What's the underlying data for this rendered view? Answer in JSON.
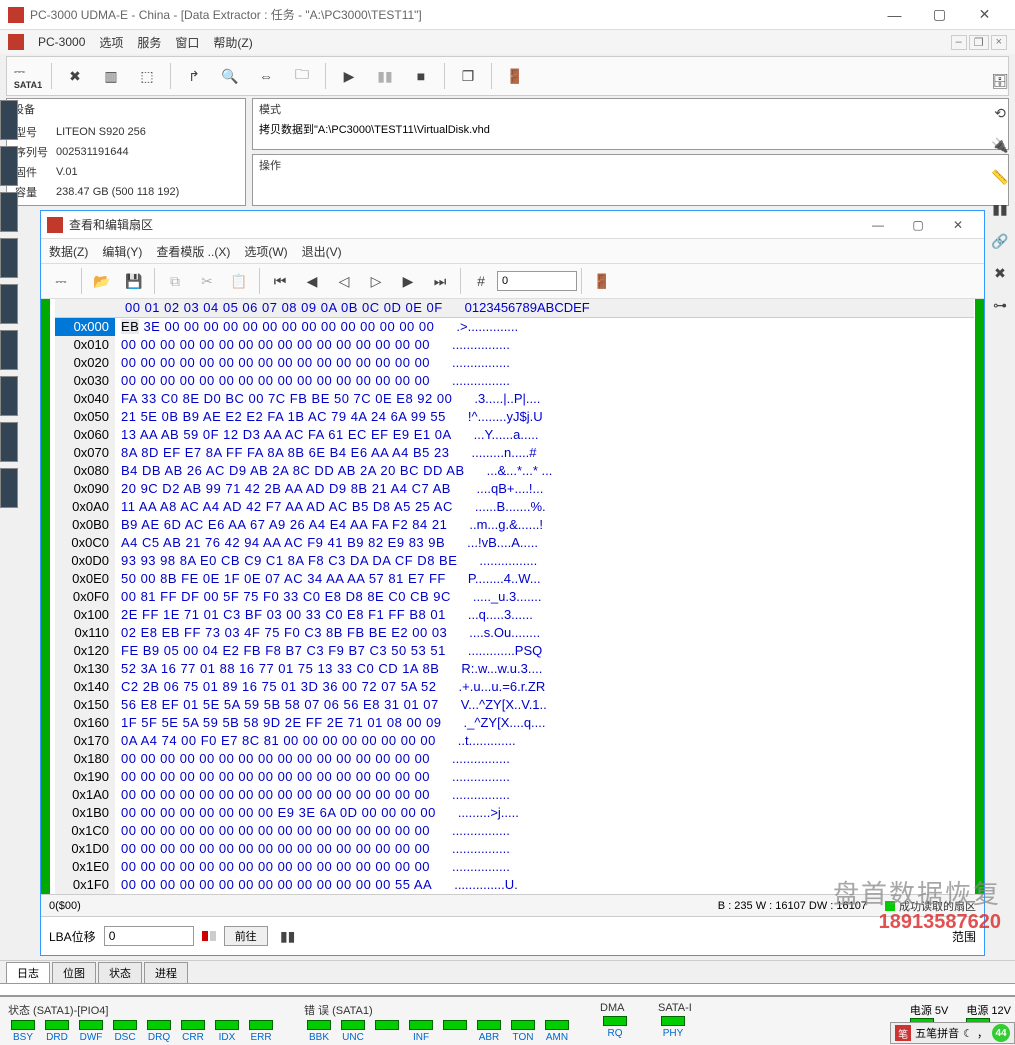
{
  "window": {
    "title": "PC-3000 UDMA-E - China - [Data Extractor : 任务 - \"A:\\PC3000\\TEST11\"]"
  },
  "main_menu": {
    "items": [
      "PC-3000",
      "选项",
      "服务",
      "窗口",
      "帮助(Z)"
    ]
  },
  "toolbar_main": {
    "sata_label": "SATA1"
  },
  "device_panel": {
    "title": "设备",
    "rows": [
      {
        "label": "型号",
        "value": "LITEON S920 256"
      },
      {
        "label": "序列号",
        "value": "002531191644"
      },
      {
        "label": "固件",
        "value": "V.01"
      },
      {
        "label": "容量",
        "value": "238.47 GB (500 118 192)"
      }
    ]
  },
  "mode_panel": {
    "title": "模式",
    "value": "拷贝数据到\"A:\\PC3000\\TEST11\\VirtualDisk.vhd"
  },
  "op_panel": {
    "title": "操作"
  },
  "inner": {
    "title": "查看和编辑扇区",
    "menu": [
      "数据(Z)",
      "编辑(Y)",
      "查看模版 ..(X)",
      "选项(W)",
      "退出(V)"
    ],
    "input_value": "0"
  },
  "hex": {
    "header_offsets": "00 01 02 03 04 05 06 07 08 09 0A 0B 0C 0D 0E 0F",
    "header_ascii": "0123456789ABCDEF",
    "rows": [
      {
        "addr": "0x000",
        "selected": true,
        "bytes": [
          "EB",
          "3E",
          "00",
          "00",
          "00",
          "00",
          "00",
          "00",
          "00",
          "00",
          "00",
          "00",
          "00",
          "00",
          "00",
          "00"
        ],
        "ascii": ".>.............."
      },
      {
        "addr": "0x010",
        "bytes": [
          "00",
          "00",
          "00",
          "00",
          "00",
          "00",
          "00",
          "00",
          "00",
          "00",
          "00",
          "00",
          "00",
          "00",
          "00",
          "00"
        ],
        "ascii": "................"
      },
      {
        "addr": "0x020",
        "bytes": [
          "00",
          "00",
          "00",
          "00",
          "00",
          "00",
          "00",
          "00",
          "00",
          "00",
          "00",
          "00",
          "00",
          "00",
          "00",
          "00"
        ],
        "ascii": "................"
      },
      {
        "addr": "0x030",
        "bytes": [
          "00",
          "00",
          "00",
          "00",
          "00",
          "00",
          "00",
          "00",
          "00",
          "00",
          "00",
          "00",
          "00",
          "00",
          "00",
          "00"
        ],
        "ascii": "................"
      },
      {
        "addr": "0x040",
        "bytes": [
          "FA",
          "33",
          "C0",
          "8E",
          "D0",
          "BC",
          "00",
          "7C",
          "FB",
          "BE",
          "50",
          "7C",
          "0E",
          "E8",
          "92",
          "00"
        ],
        "ascii": ".3.....|..P|...."
      },
      {
        "addr": "0x050",
        "bytes": [
          "21",
          "5E",
          "0B",
          "B9",
          "AE",
          "E2",
          "E2",
          "FA",
          "1B",
          "AC",
          "79",
          "4A",
          "24",
          "6A",
          "99",
          "55"
        ],
        "ascii": "!^........yJ$j.U"
      },
      {
        "addr": "0x060",
        "bytes": [
          "13",
          "AA",
          "AB",
          "59",
          "0F",
          "12",
          "D3",
          "AA",
          "AC",
          "FA",
          "61",
          "EC",
          "EF",
          "E9",
          "E1",
          "0A"
        ],
        "ascii": "...Y......a....."
      },
      {
        "addr": "0x070",
        "bytes": [
          "8A",
          "8D",
          "EF",
          "E7",
          "8A",
          "FF",
          "FA",
          "8A",
          "8B",
          "6E",
          "B4",
          "E6",
          "AA",
          "A4",
          "B5",
          "23"
        ],
        "ascii": ".........n.....#"
      },
      {
        "addr": "0x080",
        "bytes": [
          "B4",
          "DB",
          "AB",
          "26",
          "AC",
          "D9",
          "AB",
          "2A",
          "8C",
          "DD",
          "AB",
          "2A",
          "20",
          "BC",
          "DD",
          "AB"
        ],
        "ascii": "...&...*...* ..."
      },
      {
        "addr": "0x090",
        "bytes": [
          "20",
          "9C",
          "D2",
          "AB",
          "99",
          "71",
          "42",
          "2B",
          "AA",
          "AD",
          "D9",
          "8B",
          "21",
          "A4",
          "C7",
          "AB"
        ],
        "ascii": " ....qB+....!..."
      },
      {
        "addr": "0x0A0",
        "bytes": [
          "11",
          "AA",
          "A8",
          "AC",
          "A4",
          "AD",
          "42",
          "F7",
          "AA",
          "AD",
          "AC",
          "B5",
          "D8",
          "A5",
          "25",
          "AC"
        ],
        "ascii": "......B.......%."
      },
      {
        "addr": "0x0B0",
        "bytes": [
          "B9",
          "AE",
          "6D",
          "AC",
          "E6",
          "AA",
          "67",
          "A9",
          "26",
          "A4",
          "E4",
          "AA",
          "FA",
          "F2",
          "84",
          "21"
        ],
        "ascii": "..m...g.&......!"
      },
      {
        "addr": "0x0C0",
        "bytes": [
          "A4",
          "C5",
          "AB",
          "21",
          "76",
          "42",
          "94",
          "AA",
          "AC",
          "F9",
          "41",
          "B9",
          "82",
          "E9",
          "83",
          "9B"
        ],
        "ascii": "...!vB....A....."
      },
      {
        "addr": "0x0D0",
        "bytes": [
          "93",
          "93",
          "98",
          "8A",
          "E0",
          "CB",
          "C9",
          "C1",
          "8A",
          "F8",
          "C3",
          "DA",
          "DA",
          "CF",
          "D8",
          "BE"
        ],
        "ascii": "................"
      },
      {
        "addr": "0x0E0",
        "bytes": [
          "50",
          "00",
          "8B",
          "FE",
          "0E",
          "1F",
          "0E",
          "07",
          "AC",
          "34",
          "AA",
          "AA",
          "57",
          "81",
          "E7",
          "FF"
        ],
        "ascii": "P........4..W..."
      },
      {
        "addr": "0x0F0",
        "bytes": [
          "00",
          "81",
          "FF",
          "DF",
          "00",
          "5F",
          "75",
          "F0",
          "33",
          "C0",
          "E8",
          "D8",
          "8E",
          "C0",
          "CB",
          "9C"
        ],
        "ascii": "....._u.3......."
      },
      {
        "addr": "0x100",
        "bytes": [
          "2E",
          "FF",
          "1E",
          "71",
          "01",
          "C3",
          "BF",
          "03",
          "00",
          "33",
          "C0",
          "E8",
          "F1",
          "FF",
          "B8",
          "01"
        ],
        "ascii": "...q.....3......"
      },
      {
        "addr": "0x110",
        "bytes": [
          "02",
          "E8",
          "EB",
          "FF",
          "73",
          "03",
          "4F",
          "75",
          "F0",
          "C3",
          "8B",
          "FB",
          "BE",
          "E2",
          "00",
          "03"
        ],
        "ascii": "....s.Ou........"
      },
      {
        "addr": "0x120",
        "bytes": [
          "FE",
          "B9",
          "05",
          "00",
          "04",
          "E2",
          "FB",
          "F8",
          "B7",
          "C3",
          "F9",
          "B7",
          "C3",
          "50",
          "53",
          "51"
        ],
        "ascii": ".............PSQ"
      },
      {
        "addr": "0x130",
        "bytes": [
          "52",
          "3A",
          "16",
          "77",
          "01",
          "88",
          "16",
          "77",
          "01",
          "75",
          "13",
          "33",
          "C0",
          "CD",
          "1A",
          "8B"
        ],
        "ascii": "R:.w...w.u.3...."
      },
      {
        "addr": "0x140",
        "bytes": [
          "C2",
          "2B",
          "06",
          "75",
          "01",
          "89",
          "16",
          "75",
          "01",
          "3D",
          "36",
          "00",
          "72",
          "07",
          "5A",
          "52"
        ],
        "ascii": ".+.u...u.=6.r.ZR"
      },
      {
        "addr": "0x150",
        "bytes": [
          "56",
          "E8",
          "EF",
          "01",
          "5E",
          "5A",
          "59",
          "5B",
          "58",
          "07",
          "06",
          "56",
          "E8",
          "31",
          "01",
          "07"
        ],
        "ascii": "V...^ZY[X..V.1.."
      },
      {
        "addr": "0x160",
        "bytes": [
          "1F",
          "5F",
          "5E",
          "5A",
          "59",
          "5B",
          "58",
          "9D",
          "2E",
          "FF",
          "2E",
          "71",
          "01",
          "08",
          "00",
          "09"
        ],
        "ascii": "._^ZY[X....q...."
      },
      {
        "addr": "0x170",
        "bytes": [
          "0A",
          "A4",
          "74",
          "00",
          "F0",
          "E7",
          "8C",
          "81",
          "00",
          "00",
          "00",
          "00",
          "00",
          "00",
          "00",
          "00"
        ],
        "ascii": "..t............."
      },
      {
        "addr": "0x180",
        "bytes": [
          "00",
          "00",
          "00",
          "00",
          "00",
          "00",
          "00",
          "00",
          "00",
          "00",
          "00",
          "00",
          "00",
          "00",
          "00",
          "00"
        ],
        "ascii": "................"
      },
      {
        "addr": "0x190",
        "bytes": [
          "00",
          "00",
          "00",
          "00",
          "00",
          "00",
          "00",
          "00",
          "00",
          "00",
          "00",
          "00",
          "00",
          "00",
          "00",
          "00"
        ],
        "ascii": "................"
      },
      {
        "addr": "0x1A0",
        "bytes": [
          "00",
          "00",
          "00",
          "00",
          "00",
          "00",
          "00",
          "00",
          "00",
          "00",
          "00",
          "00",
          "00",
          "00",
          "00",
          "00"
        ],
        "ascii": "................"
      },
      {
        "addr": "0x1B0",
        "bytes": [
          "00",
          "00",
          "00",
          "00",
          "00",
          "00",
          "00",
          "00",
          "E9",
          "3E",
          "6A",
          "0D",
          "00",
          "00",
          "00",
          "00"
        ],
        "ascii": ".........>j....."
      },
      {
        "addr": "0x1C0",
        "bytes": [
          "00",
          "00",
          "00",
          "00",
          "00",
          "00",
          "00",
          "00",
          "00",
          "00",
          "00",
          "00",
          "00",
          "00",
          "00",
          "00"
        ],
        "ascii": "................"
      },
      {
        "addr": "0x1D0",
        "bytes": [
          "00",
          "00",
          "00",
          "00",
          "00",
          "00",
          "00",
          "00",
          "00",
          "00",
          "00",
          "00",
          "00",
          "00",
          "00",
          "00"
        ],
        "ascii": "................"
      },
      {
        "addr": "0x1E0",
        "bytes": [
          "00",
          "00",
          "00",
          "00",
          "00",
          "00",
          "00",
          "00",
          "00",
          "00",
          "00",
          "00",
          "00",
          "00",
          "00",
          "00"
        ],
        "ascii": "................"
      },
      {
        "addr": "0x1F0",
        "bytes": [
          "00",
          "00",
          "00",
          "00",
          "00",
          "00",
          "00",
          "00",
          "00",
          "00",
          "00",
          "00",
          "00",
          "00",
          "55",
          "AA"
        ],
        "ascii": "..............U."
      }
    ]
  },
  "hex_status": {
    "pos": "0($00)",
    "bw": "B : 235 W : 16107 DW : 16107",
    "msg": "成功读取的扇区"
  },
  "lba": {
    "label": "LBA位移",
    "value": "0",
    "go": "前往",
    "range": "范围"
  },
  "tabs": {
    "items": [
      "日志",
      "位图",
      "状态",
      "进程"
    ],
    "active": 0
  },
  "status": {
    "group1_title": "状态 (SATA1)-[PIO4]",
    "group1": [
      "BSY",
      "DRD",
      "DWF",
      "DSC",
      "DRQ",
      "CRR",
      "IDX",
      "ERR"
    ],
    "group2_title": "错 误 (SATA1)",
    "group2": [
      "BBK",
      "UNC",
      "",
      "INF",
      "",
      "ABR",
      "TON",
      "AMN"
    ],
    "dma_title": "DMA",
    "dma": [
      "RQ"
    ],
    "sata_title": "SATA-I",
    "sata": [
      "PHY"
    ],
    "power5": "电源 5V",
    "power12": "电源 12V"
  },
  "watermark": {
    "l1": "盘首数据恢复",
    "l2": "18913587620"
  },
  "ime": {
    "label": "五笔拼音",
    "badge": "44"
  }
}
